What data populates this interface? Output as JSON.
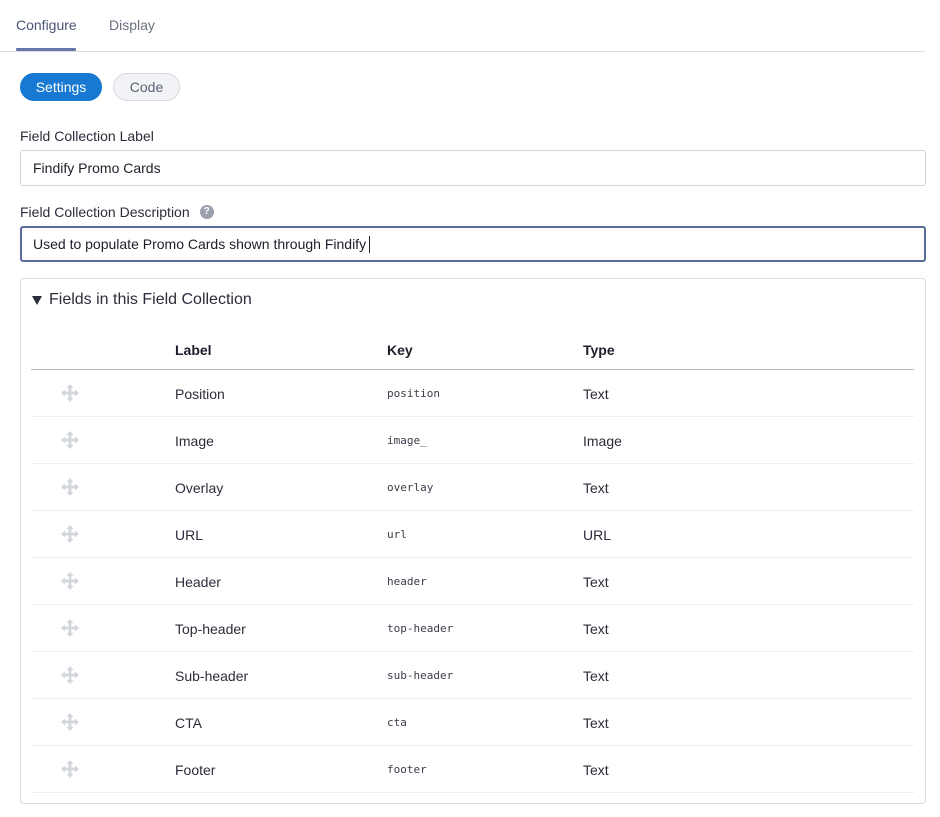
{
  "tabs": [
    {
      "label": "Configure",
      "active": true
    },
    {
      "label": "Display",
      "active": false
    }
  ],
  "mode_buttons": {
    "settings": "Settings",
    "code": "Code"
  },
  "collection_label": {
    "label": "Field Collection Label",
    "value": "Findify Promo Cards"
  },
  "collection_description": {
    "label": "Field Collection Description",
    "help_icon": "question-circle-icon",
    "value": "Used to populate Promo Cards shown through Findify"
  },
  "fields_panel": {
    "title": "Fields in this Field Collection",
    "columns": {
      "label": "Label",
      "key": "Key",
      "type": "Type"
    },
    "rows": [
      {
        "label": "Position",
        "key": "position",
        "type": "Text"
      },
      {
        "label": "Image",
        "key": "image_",
        "type": "Image"
      },
      {
        "label": "Overlay",
        "key": "overlay",
        "type": "Text"
      },
      {
        "label": "URL",
        "key": "url",
        "type": "URL"
      },
      {
        "label": "Header",
        "key": "header",
        "type": "Text"
      },
      {
        "label": "Top-header",
        "key": "top-header",
        "type": "Text"
      },
      {
        "label": "Sub-header",
        "key": "sub-header",
        "type": "Text"
      },
      {
        "label": "CTA",
        "key": "cta",
        "type": "Text"
      },
      {
        "label": "Footer",
        "key": "footer",
        "type": "Text"
      }
    ]
  },
  "colors": {
    "accent": "#1779d2",
    "tab_underline": "#6677a8",
    "focus_border": "#5b6b9b",
    "drag_icon": "#d3d6dc"
  }
}
